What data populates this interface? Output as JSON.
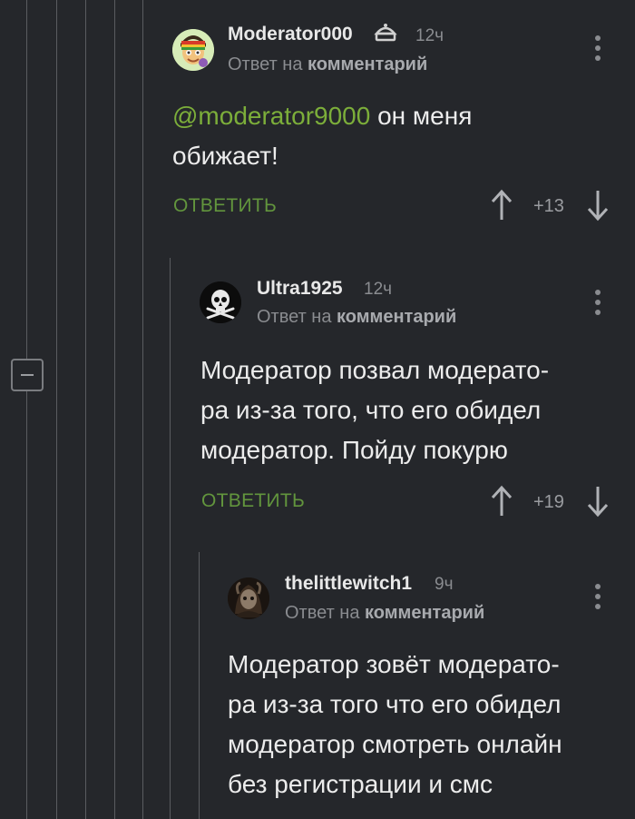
{
  "comments": [
    {
      "author": "Moderator000",
      "time": "12ч",
      "reply_prefix": "Ответ на ",
      "reply_target": "комментарий",
      "mention": "@moderator9000",
      "text_after_mention": " он меня обижает!",
      "reply_label": "ОТВЕТИТЬ",
      "rating": "+13"
    },
    {
      "author": "Ultra1925",
      "time": "12ч",
      "reply_prefix": "Ответ на ",
      "reply_target": "комментарий",
      "text_lines": [
        "Модератор позвал модерато-",
        "ра из-за того, что его обидел",
        "модератор. Пойду покурю"
      ],
      "reply_label": "ОТВЕТИТЬ",
      "rating": "+19"
    },
    {
      "author": "thelittlewitch1",
      "time": "9ч",
      "reply_prefix": "Ответ на ",
      "reply_target": "комментарий",
      "text_lines": [
        "Модератор зовёт модерато-",
        "ра из-за того что его обидел",
        "модератор смотреть онлайн",
        "без регистрации и смс"
      ]
    }
  ],
  "colors": {
    "background": "#25272b",
    "accent_green": "#62953d",
    "mention_green": "#7cae3a"
  }
}
